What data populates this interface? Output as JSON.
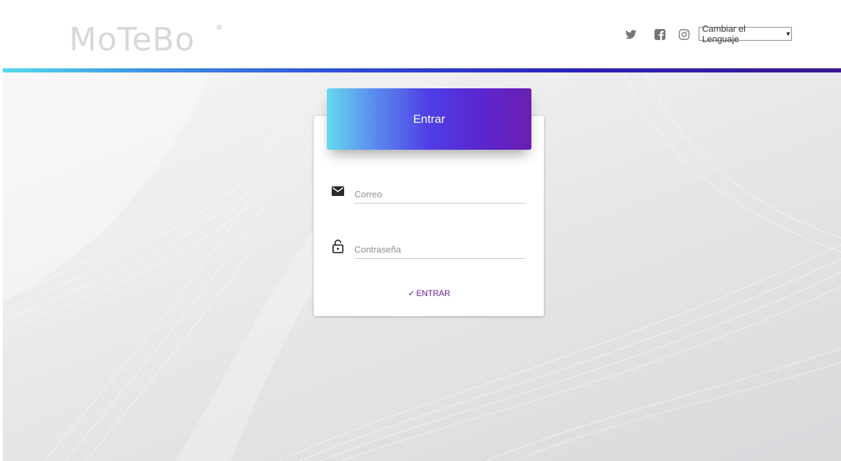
{
  "header": {
    "logo_text": "MoTeBo",
    "language_select_value": "Cambiar el Lenguaje",
    "social": [
      "twitter-icon",
      "facebook-icon",
      "instagram-icon"
    ]
  },
  "login": {
    "title": "Entrar",
    "email_placeholder": "Correo",
    "password_placeholder": "Contraseña",
    "submit_label": "ENTRAR"
  },
  "colors": {
    "accent": "#6a1b9a",
    "header_gradient_start": "#66d9ef",
    "header_gradient_end": "#6b1fb0"
  }
}
